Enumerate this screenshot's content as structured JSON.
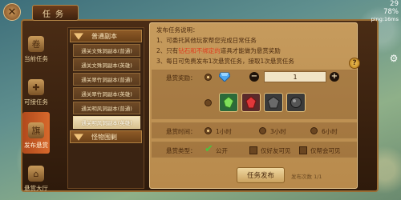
{
  "window": {
    "title": "任务"
  },
  "status": {
    "time": "29",
    "battery": "78%",
    "ping": "ping:16ms"
  },
  "left_tabs": [
    {
      "label": "当前任务",
      "icon": "scroll-icon"
    },
    {
      "label": "可接任务",
      "icon": "plus-scroll-icon"
    },
    {
      "label": "发布悬赏",
      "icon": "banner-icon",
      "active": true
    },
    {
      "label": "悬赏大厅",
      "icon": "hall-icon"
    }
  ],
  "categories": {
    "group1": "普通副本",
    "items": [
      "通关文殊洞副本(普通)",
      "通关文殊洞副本(英雄)",
      "通关翠竹洞副本(普通)",
      "通关翠竹洞副本(英雄)",
      "通关明风洞副本(普通)",
      "通关明风洞副本(英雄)"
    ],
    "selected_index": 5,
    "group2": "怪物围剿"
  },
  "desc": {
    "title": "发布任务说明：",
    "line1": "1、可委托其他玩家帮您完成日常任务",
    "line2_pre": "2、只有",
    "line2_hl": "钻石和不绑定的",
    "line2_post": "道具才能做为悬赏奖励",
    "line3": "3、每日可免费发布1次悬赏任务，接取1次悬赏任务"
  },
  "reward": {
    "label": "悬赏奖励：",
    "quantity": "1",
    "minus": "−",
    "plus": "+"
  },
  "time": {
    "label": "悬赏时间：",
    "options": [
      "1小时",
      "3小时",
      "6小时"
    ],
    "selected": 0
  },
  "type": {
    "label": "悬赏类型：",
    "options": [
      "公开",
      "仅好友可见",
      "仅帮会可见"
    ]
  },
  "publish": {
    "button": "任务发布",
    "count": "发布次数 1/1"
  },
  "colors": {
    "accent": "#d7692c",
    "panel": "#c69b5d",
    "highlight": "#e03c1e"
  }
}
